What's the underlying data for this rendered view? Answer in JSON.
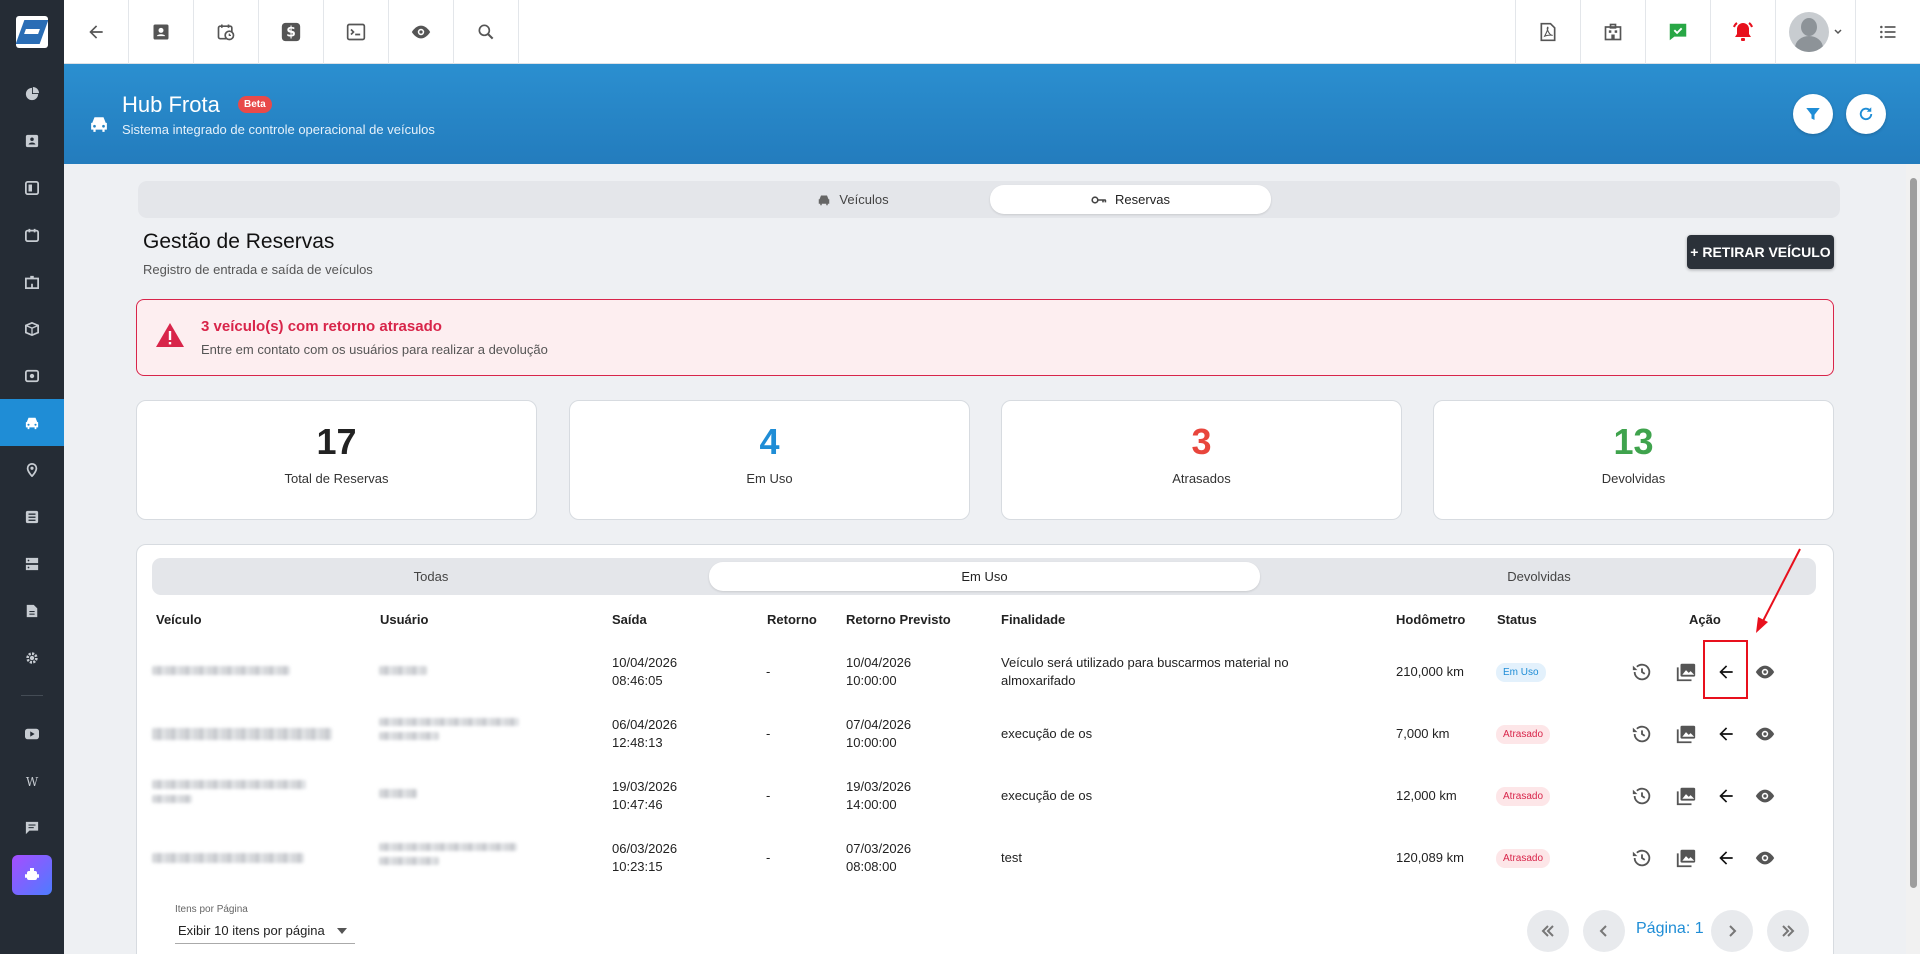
{
  "topbar": {
    "left_icons": [
      "back-arrow-icon",
      "contact-card-icon",
      "calendar-clock-icon",
      "dollar-icon",
      "terminal-icon",
      "eye-icon",
      "search-icon"
    ],
    "right_icons": [
      "pdf-file-icon",
      "building-icon",
      "chat-check-icon",
      "alarm-bell-icon"
    ],
    "status_colors": {
      "chat": "#28a745",
      "alarm": "#e8101d"
    }
  },
  "sidebar": {
    "items": [
      "chart-pie-icon",
      "address-card-icon",
      "board-icon",
      "calendar-icon",
      "building-icon",
      "box-icon",
      "money-icon",
      "car-icon",
      "map-pin-icon",
      "list-icon",
      "server-icon",
      "document-icon",
      "gear-icon"
    ],
    "active_item": "car-icon",
    "bottom_items": [
      "youtube-icon",
      "wiki-icon",
      "chat-icon",
      "app-launcher-icon"
    ]
  },
  "header": {
    "title": "Hub Frota",
    "badge": "Beta",
    "subtitle": "Sistema integrado de controle operacional de veículos"
  },
  "main_tabs": [
    {
      "label": "Veículos",
      "active": false
    },
    {
      "label": "Reservas",
      "active": true
    }
  ],
  "page": {
    "title": "Gestão de Reservas",
    "subtitle": "Registro de entrada e saída de veículos",
    "primary_button": "+ RETIRAR VEÍCULO"
  },
  "alert": {
    "title": "3 veículo(s) com retorno atrasado",
    "text": "Entre em contato com os usuários para realizar a devolução"
  },
  "stats": [
    {
      "value": "17",
      "label": "Total de Reservas",
      "color": "#222222"
    },
    {
      "value": "4",
      "label": "Em Uso",
      "color": "#1f8dd6"
    },
    {
      "value": "3",
      "label": "Atrasados",
      "color": "#e8453c"
    },
    {
      "value": "13",
      "label": "Devolvidas",
      "color": "#3fa34d"
    }
  ],
  "sub_tabs": [
    {
      "label": "Todas",
      "active": false
    },
    {
      "label": "Em Uso",
      "active": true
    },
    {
      "label": "Devolvidas",
      "active": false
    }
  ],
  "table": {
    "headers": [
      "Veículo",
      "Usuário",
      "Saída",
      "Retorno",
      "Retorno Previsto",
      "Finalidade",
      "Hodômetro",
      "Status",
      "Ação"
    ],
    "rows": [
      {
        "saida_date": "10/04/2026",
        "saida_time": "08:46:05",
        "retorno": "-",
        "previsto_date": "10/04/2026",
        "previsto_time": "10:00:00",
        "finalidade": "Veículo será utilizado para buscarmos material no almoxarifado",
        "hodometro": "210,000 km",
        "status": "Em Uso"
      },
      {
        "saida_date": "06/04/2026",
        "saida_time": "12:48:13",
        "retorno": "-",
        "previsto_date": "07/04/2026",
        "previsto_time": "10:00:00",
        "finalidade": "execução de os",
        "hodometro": "7,000 km",
        "status": "Atrasado"
      },
      {
        "saida_date": "19/03/2026",
        "saida_time": "10:47:46",
        "retorno": "-",
        "previsto_date": "19/03/2026",
        "previsto_time": "14:00:00",
        "finalidade": "execução de os",
        "hodometro": "12,000 km",
        "status": "Atrasado"
      },
      {
        "saida_date": "06/03/2026",
        "saida_time": "10:23:15",
        "retorno": "-",
        "previsto_date": "07/03/2026",
        "previsto_time": "08:08:00",
        "finalidade": "test",
        "hodometro": "120,089 km",
        "status": "Atrasado"
      }
    ],
    "row_actions": [
      "history-icon",
      "photos-icon",
      "return-arrow-icon",
      "eye-icon"
    ]
  },
  "pagination": {
    "items_label": "Itens por Página",
    "items_value": "Exibir 10 itens por página",
    "page_text": "Página: 1"
  }
}
